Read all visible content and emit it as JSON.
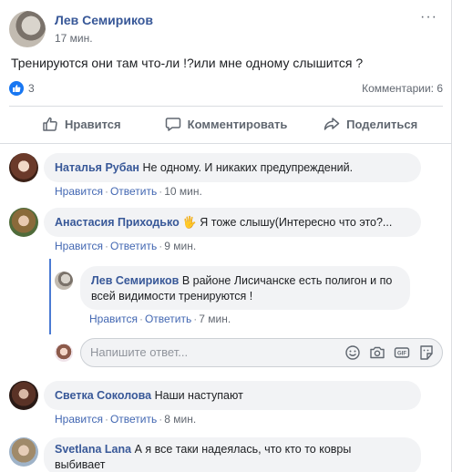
{
  "post": {
    "author": "Лев Семириков",
    "time": "17 мин.",
    "more_icon": "···",
    "text": "Тренируются они там что-ли !?или мне одному слышится ?",
    "reactions_count": "3",
    "comments_count": "Комментарии: 6"
  },
  "actions": {
    "like": "Нравится",
    "comment": "Комментировать",
    "share": "Поделиться"
  },
  "comments": [
    {
      "name": "Наталья Рубан",
      "text": "Не одному. И никаких предупреждений.",
      "like": "Нравится",
      "reply": "Ответить",
      "time": "10 мин."
    },
    {
      "name": "Анастасия Приходько",
      "emoji": "🖐",
      "text": "Я тоже слышу(Интересно что это?...",
      "like": "Нравится",
      "reply": "Ответить",
      "time": "9 мин."
    },
    {
      "name": "Светка Соколова",
      "text": "Наши наступают",
      "like": "Нравится",
      "reply": "Ответить",
      "time": "8 мин."
    },
    {
      "name": "Svetlana Lana",
      "text_line1": "А я все таки надеялась, что кто то ковры",
      "text_line2": "выбивает"
    }
  ],
  "reply": {
    "name": "Лев Семириков",
    "text_line1": "В районе Лисичанске есть полигон и по",
    "text_line2": "всей видимости тренируются !",
    "like": "Нравится",
    "reply": "Ответить",
    "time": "7 мин."
  },
  "reply_input": {
    "placeholder": "Напишите ответ..."
  },
  "colors": {
    "link": "#385898",
    "accent": "#1877f2",
    "bubble": "#f2f3f5",
    "thread_line": "#4b7bd3"
  }
}
